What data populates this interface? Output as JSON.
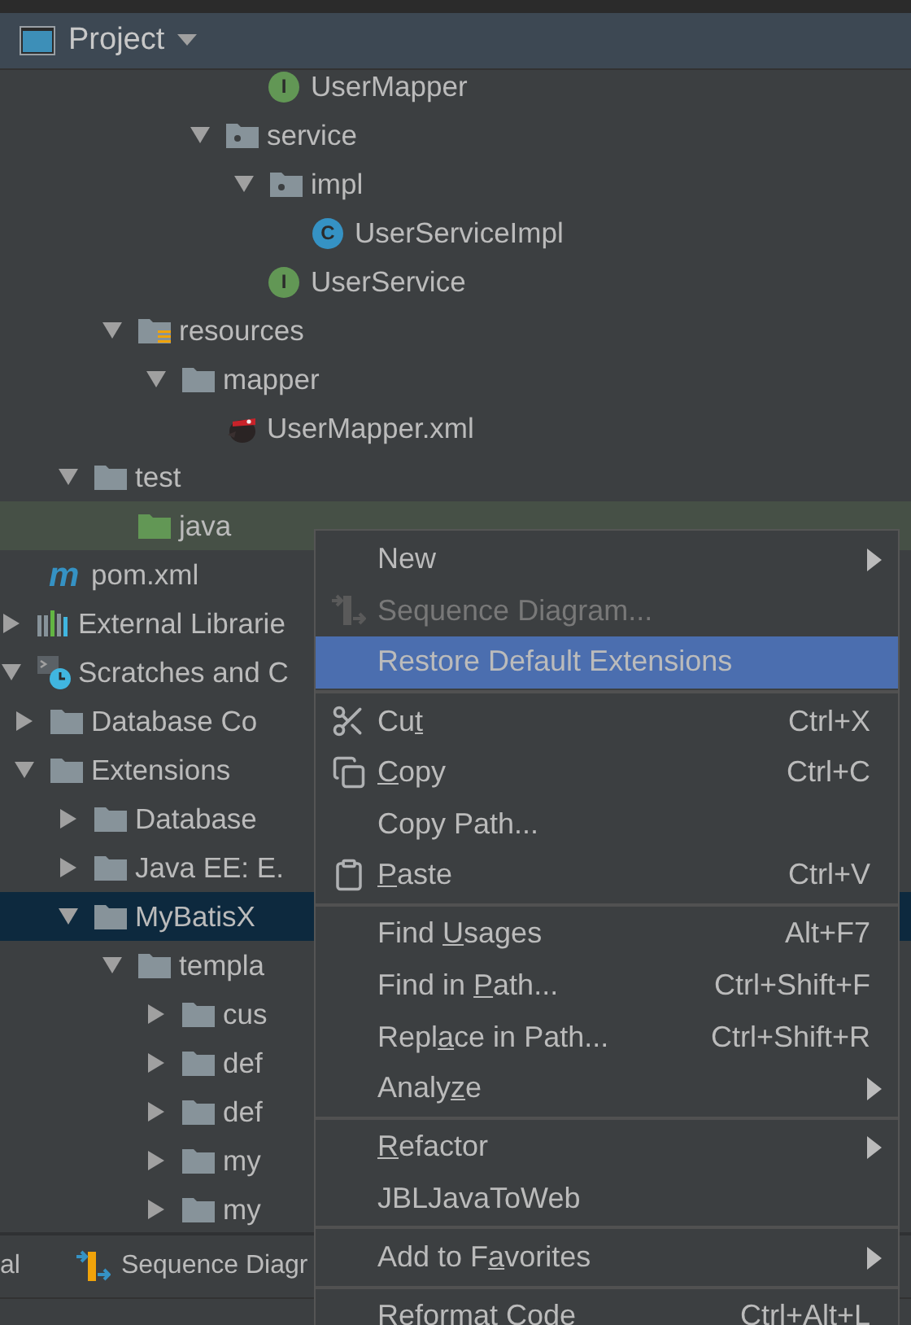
{
  "panel": {
    "title": "Project"
  },
  "tree": [
    {
      "children": [
        {
          "children": [
            {
              "children": [
                {
                  "children": [
                    {
                      "children": [
                        {
                          "children": [
                            {
                              "label": "UserMapper",
                              "kind": "interface",
                              "icon_text": "I",
                              "selected": false
                            }
                          ]
                        },
                        {
                          "label": "service",
                          "kind": "package",
                          "expanded": true,
                          "selected": false,
                          "children": [
                            {
                              "label": "impl",
                              "kind": "package",
                              "expanded": true,
                              "selected": false,
                              "children": [
                                {
                                  "label": "UserServiceImpl",
                                  "kind": "class",
                                  "icon_text": "C",
                                  "selected": false
                                }
                              ]
                            },
                            {
                              "label": "UserService",
                              "kind": "interface",
                              "icon_text": "I",
                              "selected": false
                            }
                          ]
                        }
                      ]
                    }
                  ]
                },
                {
                  "label": "resources",
                  "kind": "resources",
                  "expanded": true,
                  "selected": false,
                  "children": [
                    {
                      "label": "mapper",
                      "kind": "folder",
                      "expanded": true,
                      "selected": false,
                      "children": [
                        {
                          "label": "UserMapper.xml",
                          "kind": "mybatis",
                          "selected": false
                        }
                      ]
                    }
                  ]
                }
              ]
            },
            {
              "label": "test",
              "kind": "folder",
              "expanded": true,
              "selected": false,
              "children": [
                {
                  "label": "java",
                  "kind": "test-source",
                  "selected": false
                }
              ]
            }
          ]
        },
        {
          "label": "pom.xml",
          "kind": "maven",
          "icon_text": "m",
          "selected": false
        }
      ]
    },
    {
      "label": "External Librarie",
      "kind": "libraries",
      "expanded": false,
      "selected": false
    },
    {
      "label": "Scratches and C",
      "kind": "scratches",
      "expanded": true,
      "selected": false,
      "children": [
        {
          "label": "Database Co",
          "kind": "folder",
          "expanded": false,
          "selected": false
        },
        {
          "label": "Extensions",
          "kind": "folder",
          "expanded": true,
          "selected": false,
          "children": [
            {
              "label": "Database",
              "kind": "folder",
              "expanded": false,
              "selected": false
            },
            {
              "label": "Java EE: E.",
              "kind": "folder",
              "expanded": false,
              "selected": false
            },
            {
              "label": "MyBatisX",
              "kind": "folder",
              "expanded": true,
              "selected": true,
              "children": [
                {
                  "label": "templa",
                  "kind": "folder",
                  "expanded": true,
                  "selected": false,
                  "children": [
                    {
                      "label": "cus",
                      "kind": "folder",
                      "expanded": false,
                      "selected": false
                    },
                    {
                      "label": "def",
                      "kind": "folder",
                      "expanded": false,
                      "selected": false
                    },
                    {
                      "label": "def",
                      "kind": "folder",
                      "expanded": false,
                      "selected": false
                    },
                    {
                      "label": "my",
                      "kind": "folder",
                      "expanded": false,
                      "selected": false
                    },
                    {
                      "label": "my",
                      "kind": "folder",
                      "expanded": false,
                      "selected": false
                    }
                  ]
                }
              ]
            }
          ]
        }
      ]
    }
  ],
  "bottom_tabs": [
    {
      "label": "al",
      "kind": "plain"
    },
    {
      "label": "Sequence Diagr",
      "kind": "sequence"
    }
  ],
  "context_menu": [
    {
      "kind": "plain",
      "label": "New",
      "submenu": true,
      "disabled": false,
      "selected": false
    },
    {
      "kind": "sequence",
      "label": "Sequence Diagram...",
      "submenu": false,
      "disabled": true,
      "selected": false
    },
    {
      "kind": "plain",
      "label": "Restore Default Extensions",
      "submenu": false,
      "disabled": false,
      "selected": true
    },
    {
      "kind": "separator"
    },
    {
      "kind": "scissors",
      "label_parts": {
        "before": "Cu",
        "key": "t"
      },
      "shortcut": "Ctrl+X",
      "submenu": false,
      "disabled": false,
      "selected": false
    },
    {
      "kind": "copy",
      "label_parts": {
        "key": "C",
        "after": "opy"
      },
      "shortcut": "Ctrl+C",
      "submenu": false,
      "disabled": false,
      "selected": false
    },
    {
      "kind": "plain",
      "label": "Copy Path...",
      "submenu": false,
      "disabled": false,
      "selected": false
    },
    {
      "kind": "paste",
      "label_parts": {
        "key": "P",
        "after": "aste"
      },
      "shortcut": "Ctrl+V",
      "submenu": false,
      "disabled": false,
      "selected": false
    },
    {
      "kind": "separator"
    },
    {
      "kind": "plain",
      "label_parts": {
        "before": "Find ",
        "key": "U",
        "after": "sages"
      },
      "shortcut": "Alt+F7",
      "submenu": false,
      "disabled": false,
      "selected": false
    },
    {
      "kind": "plain",
      "label_parts": {
        "before": "Find in ",
        "key": "P",
        "after": "ath..."
      },
      "shortcut": "Ctrl+Shift+F",
      "submenu": false,
      "disabled": false,
      "selected": false
    },
    {
      "kind": "plain",
      "label_parts": {
        "before": "Repl",
        "key": "a",
        "after": "ce in Path..."
      },
      "shortcut": "Ctrl+Shift+R",
      "submenu": false,
      "disabled": false,
      "selected": false
    },
    {
      "kind": "plain",
      "label_parts": {
        "before": "Analy",
        "key": "z",
        "after": "e"
      },
      "submenu": true,
      "disabled": false,
      "selected": false
    },
    {
      "kind": "separator"
    },
    {
      "kind": "plain",
      "label_parts": {
        "key": "R",
        "after": "efactor"
      },
      "submenu": true,
      "disabled": false,
      "selected": false
    },
    {
      "kind": "plain",
      "label": "JBLJavaToWeb",
      "submenu": false,
      "disabled": false,
      "selected": false
    },
    {
      "kind": "separator"
    },
    {
      "kind": "plain",
      "label_parts": {
        "before": "Add to F",
        "key": "a",
        "after": "vorites"
      },
      "submenu": true,
      "disabled": false,
      "selected": false
    },
    {
      "kind": "separator"
    },
    {
      "kind": "plain",
      "label": "Reformat Code",
      "shortcut": "Ctrl+Alt+L",
      "submenu": false,
      "disabled": false,
      "selected": false
    }
  ]
}
